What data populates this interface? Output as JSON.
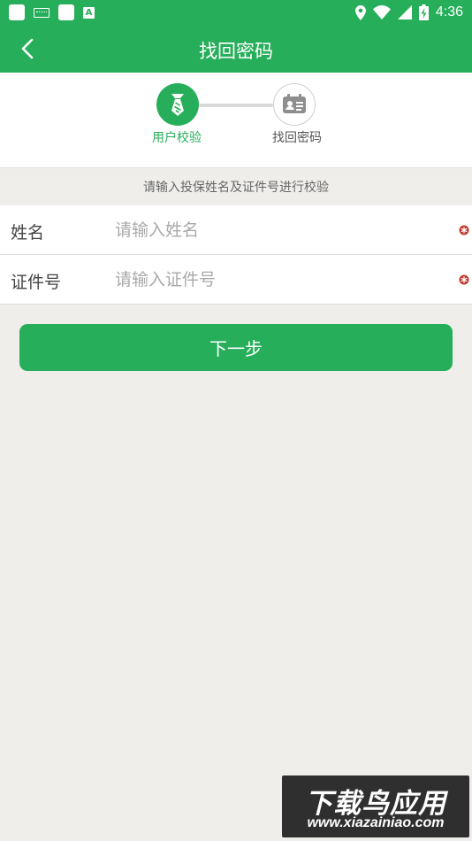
{
  "status_bar": {
    "time": "4:36",
    "left_icons": [
      "app-square-icon",
      "keyboard-icon",
      "app-square-icon",
      "a-badge-icon"
    ],
    "right_icons": [
      "location-icon",
      "wifi-icon",
      "signal-icon",
      "battery-charging-icon"
    ]
  },
  "nav": {
    "title": "找回密码",
    "back_icon": "chevron-left-icon"
  },
  "stepper": {
    "steps": [
      {
        "label": "用户校验",
        "icon": "tie-icon",
        "active": true
      },
      {
        "label": "找回密码",
        "icon": "id-card-icon",
        "active": false
      }
    ]
  },
  "hint": "请输入投保姓名及证件号进行校验",
  "form": {
    "name": {
      "label": "姓名",
      "placeholder": "请输入姓名",
      "value": ""
    },
    "id_number": {
      "label": "证件号",
      "placeholder": "请输入证件号",
      "value": ""
    }
  },
  "next_button": "下一步",
  "watermark": {
    "title": "下载鸟应用",
    "url": "www.xiazainiao.com"
  },
  "colors": {
    "primary": "#27ae5a",
    "background": "#efeeeb",
    "required": "#c0392b"
  }
}
